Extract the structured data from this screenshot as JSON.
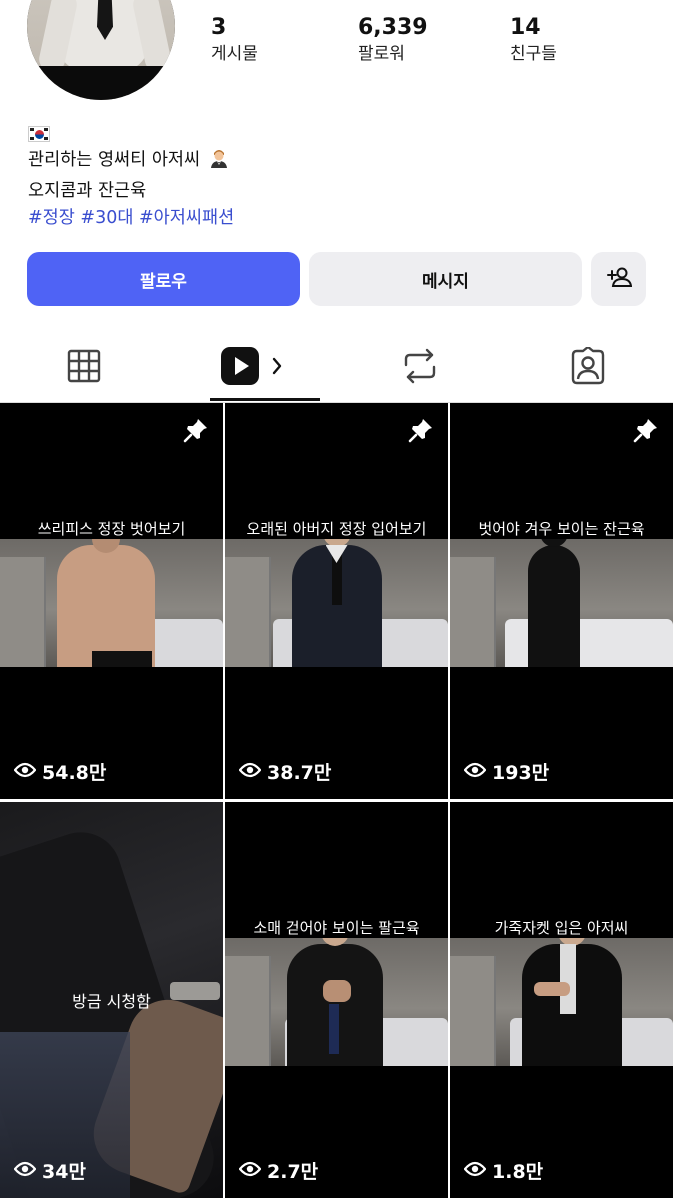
{
  "profile": {
    "stats": {
      "posts": {
        "value": "3",
        "label": "게시물"
      },
      "followers": {
        "value": "6,339",
        "label": "팔로워"
      },
      "friends": {
        "value": "14",
        "label": "친구들"
      }
    },
    "bio": {
      "flag_icon": "south-korea-flag-icon",
      "line1": "관리하는 영써티 아저씨",
      "line1_icon": "man-in-tuxedo-emoji",
      "line2": "오지콤과 잔근육",
      "hashtags": "#정장 #30대 #아저씨패션"
    }
  },
  "actions": {
    "follow_label": "팔로우",
    "message_label": "메시지",
    "add_friend_icon": "add-person-icon"
  },
  "tabs": [
    {
      "name": "grid",
      "icon": "grid-icon"
    },
    {
      "name": "reels",
      "icon": "reels-play-icon",
      "active": true
    },
    {
      "name": "reposts",
      "icon": "repost-icon"
    },
    {
      "name": "tagged",
      "icon": "tagged-person-icon"
    }
  ],
  "posts": [
    {
      "caption": "쓰리피스 정장 벗어보기",
      "views": "54.8만",
      "pinned": true
    },
    {
      "caption": "오래된 아버지 정장 입어보기",
      "views": "38.7만",
      "pinned": true
    },
    {
      "caption": "벗어야 겨우 보이는 잔근육",
      "views": "193만",
      "pinned": true
    },
    {
      "caption": "방금 시청함",
      "views": "34만",
      "pinned": false
    },
    {
      "caption": "소매 걷어야 보이는 팔근육",
      "views": "2.7만",
      "pinned": false
    },
    {
      "caption": "가죽자켓 입은 아저씨",
      "views": "1.8만",
      "pinned": false
    }
  ],
  "colors": {
    "accent": "#4f63f5",
    "hashtag": "#3a4ecf",
    "button_secondary": "#eeeef1"
  }
}
